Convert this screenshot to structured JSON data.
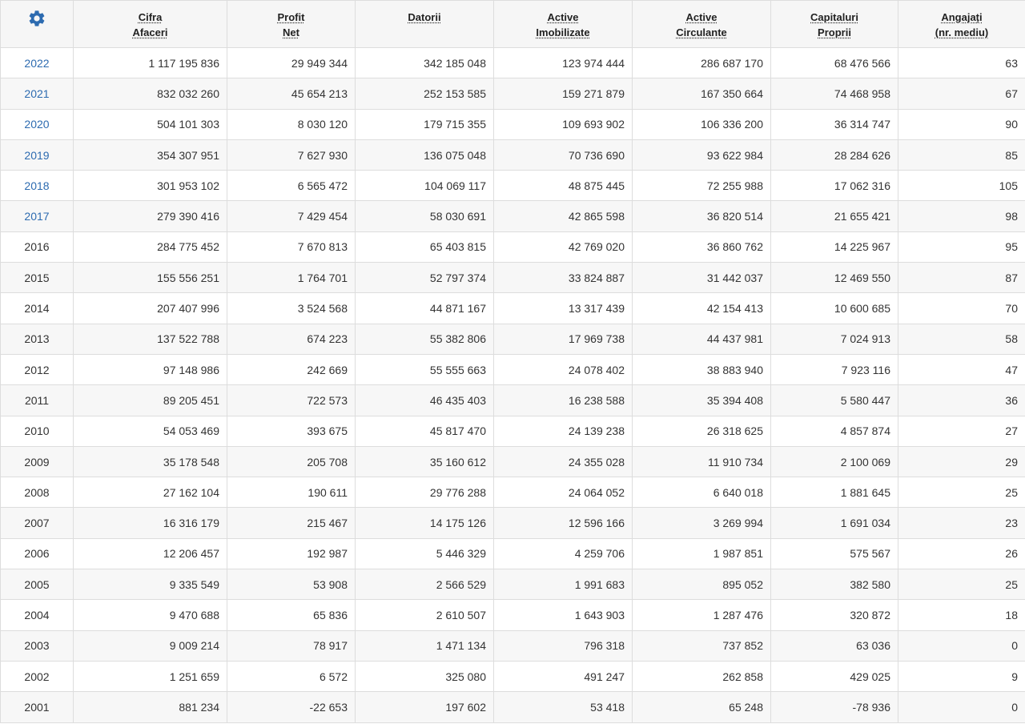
{
  "settings_icon": "gear-icon",
  "colors": {
    "accent": "#2d6bb0",
    "header_bg": "#f6f6f6",
    "row_alt_bg": "#f7f7f7",
    "border": "#dddddd"
  },
  "columns": [
    {
      "key": "cifra",
      "line1": "Cifra",
      "line2": "Afaceri"
    },
    {
      "key": "profit",
      "line1": "Profit",
      "line2": "Net"
    },
    {
      "key": "datorii",
      "line1": "Datorii",
      "line2": ""
    },
    {
      "key": "imob",
      "line1": "Active",
      "line2": "Imobilizate"
    },
    {
      "key": "circ",
      "line1": "Active",
      "line2": "Circulante"
    },
    {
      "key": "cap",
      "line1": "Capitaluri",
      "line2": "Proprii"
    },
    {
      "key": "angajati",
      "line1": "Angajați",
      "line2": "(nr. mediu)"
    }
  ],
  "rows": [
    {
      "year": "2022",
      "link": true,
      "cifra": "1 117 195 836",
      "profit": "29 949 344",
      "datorii": "342 185 048",
      "imob": "123 974 444",
      "circ": "286 687 170",
      "cap": "68 476 566",
      "angajati": "63"
    },
    {
      "year": "2021",
      "link": true,
      "cifra": "832 032 260",
      "profit": "45 654 213",
      "datorii": "252 153 585",
      "imob": "159 271 879",
      "circ": "167 350 664",
      "cap": "74 468 958",
      "angajati": "67"
    },
    {
      "year": "2020",
      "link": true,
      "cifra": "504 101 303",
      "profit": "8 030 120",
      "datorii": "179 715 355",
      "imob": "109 693 902",
      "circ": "106 336 200",
      "cap": "36 314 747",
      "angajati": "90"
    },
    {
      "year": "2019",
      "link": true,
      "cifra": "354 307 951",
      "profit": "7 627 930",
      "datorii": "136 075 048",
      "imob": "70 736 690",
      "circ": "93 622 984",
      "cap": "28 284 626",
      "angajati": "85"
    },
    {
      "year": "2018",
      "link": true,
      "cifra": "301 953 102",
      "profit": "6 565 472",
      "datorii": "104 069 117",
      "imob": "48 875 445",
      "circ": "72 255 988",
      "cap": "17 062 316",
      "angajati": "105"
    },
    {
      "year": "2017",
      "link": true,
      "cifra": "279 390 416",
      "profit": "7 429 454",
      "datorii": "58 030 691",
      "imob": "42 865 598",
      "circ": "36 820 514",
      "cap": "21 655 421",
      "angajati": "98"
    },
    {
      "year": "2016",
      "link": false,
      "cifra": "284 775 452",
      "profit": "7 670 813",
      "datorii": "65 403 815",
      "imob": "42 769 020",
      "circ": "36 860 762",
      "cap": "14 225 967",
      "angajati": "95"
    },
    {
      "year": "2015",
      "link": false,
      "cifra": "155 556 251",
      "profit": "1 764 701",
      "datorii": "52 797 374",
      "imob": "33 824 887",
      "circ": "31 442 037",
      "cap": "12 469 550",
      "angajati": "87"
    },
    {
      "year": "2014",
      "link": false,
      "cifra": "207 407 996",
      "profit": "3 524 568",
      "datorii": "44 871 167",
      "imob": "13 317 439",
      "circ": "42 154 413",
      "cap": "10 600 685",
      "angajati": "70"
    },
    {
      "year": "2013",
      "link": false,
      "cifra": "137 522 788",
      "profit": "674 223",
      "datorii": "55 382 806",
      "imob": "17 969 738",
      "circ": "44 437 981",
      "cap": "7 024 913",
      "angajati": "58"
    },
    {
      "year": "2012",
      "link": false,
      "cifra": "97 148 986",
      "profit": "242 669",
      "datorii": "55 555 663",
      "imob": "24 078 402",
      "circ": "38 883 940",
      "cap": "7 923 116",
      "angajati": "47"
    },
    {
      "year": "2011",
      "link": false,
      "cifra": "89 205 451",
      "profit": "722 573",
      "datorii": "46 435 403",
      "imob": "16 238 588",
      "circ": "35 394 408",
      "cap": "5 580 447",
      "angajati": "36"
    },
    {
      "year": "2010",
      "link": false,
      "cifra": "54 053 469",
      "profit": "393 675",
      "datorii": "45 817 470",
      "imob": "24 139 238",
      "circ": "26 318 625",
      "cap": "4 857 874",
      "angajati": "27"
    },
    {
      "year": "2009",
      "link": false,
      "cifra": "35 178 548",
      "profit": "205 708",
      "datorii": "35 160 612",
      "imob": "24 355 028",
      "circ": "11 910 734",
      "cap": "2 100 069",
      "angajati": "29"
    },
    {
      "year": "2008",
      "link": false,
      "cifra": "27 162 104",
      "profit": "190 611",
      "datorii": "29 776 288",
      "imob": "24 064 052",
      "circ": "6 640 018",
      "cap": "1 881 645",
      "angajati": "25"
    },
    {
      "year": "2007",
      "link": false,
      "cifra": "16 316 179",
      "profit": "215 467",
      "datorii": "14 175 126",
      "imob": "12 596 166",
      "circ": "3 269 994",
      "cap": "1 691 034",
      "angajati": "23"
    },
    {
      "year": "2006",
      "link": false,
      "cifra": "12 206 457",
      "profit": "192 987",
      "datorii": "5 446 329",
      "imob": "4 259 706",
      "circ": "1 987 851",
      "cap": "575 567",
      "angajati": "26"
    },
    {
      "year": "2005",
      "link": false,
      "cifra": "9 335 549",
      "profit": "53 908",
      "datorii": "2 566 529",
      "imob": "1 991 683",
      "circ": "895 052",
      "cap": "382 580",
      "angajati": "25"
    },
    {
      "year": "2004",
      "link": false,
      "cifra": "9 470 688",
      "profit": "65 836",
      "datorii": "2 610 507",
      "imob": "1 643 903",
      "circ": "1 287 476",
      "cap": "320 872",
      "angajati": "18"
    },
    {
      "year": "2003",
      "link": false,
      "cifra": "9 009 214",
      "profit": "78 917",
      "datorii": "1 471 134",
      "imob": "796 318",
      "circ": "737 852",
      "cap": "63 036",
      "angajati": "0"
    },
    {
      "year": "2002",
      "link": false,
      "cifra": "1 251 659",
      "profit": "6 572",
      "datorii": "325 080",
      "imob": "491 247",
      "circ": "262 858",
      "cap": "429 025",
      "angajati": "9"
    },
    {
      "year": "2001",
      "link": false,
      "cifra": "881 234",
      "profit": "-22 653",
      "datorii": "197 602",
      "imob": "53 418",
      "circ": "65 248",
      "cap": "-78 936",
      "angajati": "0"
    }
  ]
}
